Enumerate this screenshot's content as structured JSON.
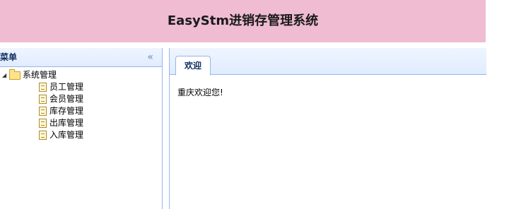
{
  "header": {
    "title": "EasyStm进销存管理系统"
  },
  "sidebar": {
    "title": "菜单",
    "collapse_glyph": "«",
    "tree": {
      "expander_glyph": "◢",
      "root_label": "系统管理",
      "items": [
        {
          "label": "员工管理"
        },
        {
          "label": "会员管理"
        },
        {
          "label": "库存管理"
        },
        {
          "label": "出库管理"
        },
        {
          "label": "入库管理"
        }
      ]
    }
  },
  "main": {
    "tabs": [
      {
        "label": "欢迎"
      }
    ],
    "welcome_text": "重庆欢迎您!"
  }
}
